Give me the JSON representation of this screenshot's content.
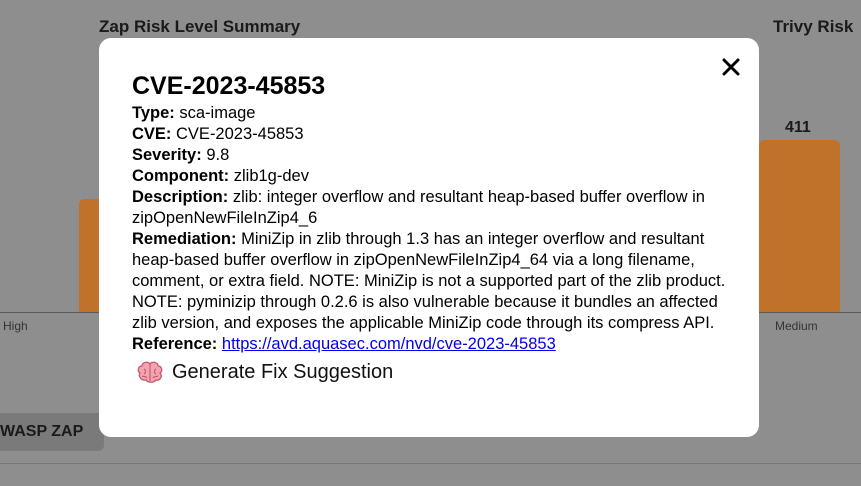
{
  "background": {
    "zap_title": "Zap Risk Level Summary",
    "trivy_title": "Trivy Risk",
    "trivy_bar_value": "411",
    "tick_high": "High",
    "tick_medium": "Medium",
    "tab_label": "WASP ZAP"
  },
  "modal": {
    "title": "CVE-2023-45853",
    "type_label": "Type:",
    "type_value": "sca-image",
    "cve_label": "CVE:",
    "cve_value": "CVE-2023-45853",
    "severity_label": "Severity:",
    "severity_value": "9.8",
    "component_label": "Component:",
    "component_value": "zlib1g-dev",
    "description_label": "Description:",
    "description_value": "zlib: integer overflow and resultant heap-based buffer overflow in zipOpenNewFileInZip4_6",
    "remediation_label": "Remediation:",
    "remediation_value": "MiniZip in zlib through 1.3 has an integer overflow and resultant heap-based buffer overflow in zipOpenNewFileInZip4_64 via a long filename, comment, or extra field. NOTE: MiniZip is not a supported part of the zlib product. NOTE: pyminizip through 0.2.6 is also vulnerable because it bundles an affected zlib version, and exposes the applicable MiniZip code through its compress API.",
    "reference_label": "Reference:",
    "reference_value": "https://avd.aquasec.com/nvd/cve-2023-45853",
    "fix_button_label": "Generate Fix Suggestion",
    "close_icon": "close-icon",
    "fix_icon": "brain-icon"
  },
  "colors": {
    "bar": "#c0712a",
    "overlay": "#8e8e8e",
    "link": "#0000ee"
  }
}
